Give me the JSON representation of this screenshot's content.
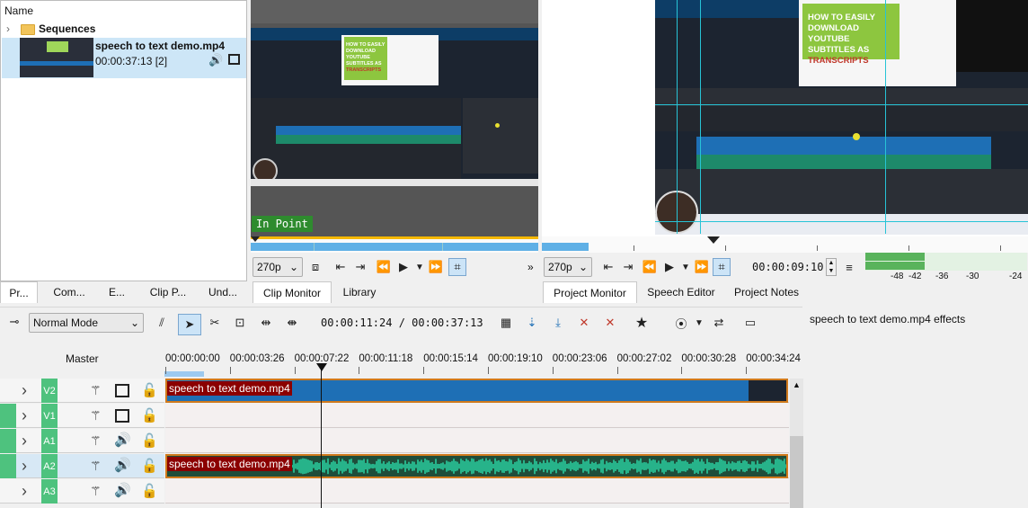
{
  "bin": {
    "header": "Name",
    "folder_label": "Sequences",
    "clip": {
      "name": "speech to text demo.mp4",
      "duration": "00:00:37:13 [2]"
    }
  },
  "left_tabs": [
    "Pr...",
    "Com...",
    "E...",
    "Clip P...",
    "Und..."
  ],
  "clip_monitor": {
    "overlay": "In Point",
    "zoom": "270p",
    "tabs": [
      "Clip Monitor",
      "Library"
    ],
    "thumbnail_text": [
      "HOW TO EASILY",
      "DOWNLOAD YOUTUBE",
      "SUBTITLES AS",
      "TRANSCRIPTS"
    ]
  },
  "project_monitor": {
    "zoom": "270p",
    "timecode": "00:00:09:10",
    "tabs": [
      "Project Monitor",
      "Speech Editor",
      "Project Notes"
    ],
    "thumbnail_text": [
      "HOW TO EASILY",
      "DOWNLOAD YOUTUBE",
      "SUBTITLES AS",
      "TRANSCRIPTS"
    ]
  },
  "audio_meter": {
    "labels": [
      "-48",
      "-42",
      "-36",
      "-30",
      "-24"
    ],
    "level_fraction": 0.15
  },
  "effects_panel": {
    "title": "speech to text demo.mp4 effects"
  },
  "timeline_toolbar": {
    "mode": "Normal Mode",
    "timecode": "00:00:11:24 / 00:00:37:13"
  },
  "timeline": {
    "master_label": "Master",
    "ruler": [
      "00:00:00:00",
      "00:00:03:26",
      "00:00:07:22",
      "00:00:11:18",
      "00:00:15:14",
      "00:00:19:10",
      "00:00:23:06",
      "00:00:27:02",
      "00:00:30:28",
      "00:00:34:24"
    ],
    "tracks": [
      {
        "id": "V2",
        "type": "video",
        "clip": "speech to text demo.mp4"
      },
      {
        "id": "V1",
        "type": "video",
        "clip": ""
      },
      {
        "id": "A1",
        "type": "audio",
        "clip": ""
      },
      {
        "id": "A2",
        "type": "audio",
        "clip": "speech to text demo.mp4"
      },
      {
        "id": "A3",
        "type": "audio",
        "clip": ""
      }
    ]
  },
  "colors": {
    "accent": "#1e6fb5",
    "track_tag": "#4ec27e",
    "clip_label": "#8b0000",
    "audio_wave": "#27b38a",
    "in_point": "#2e8b2e"
  }
}
